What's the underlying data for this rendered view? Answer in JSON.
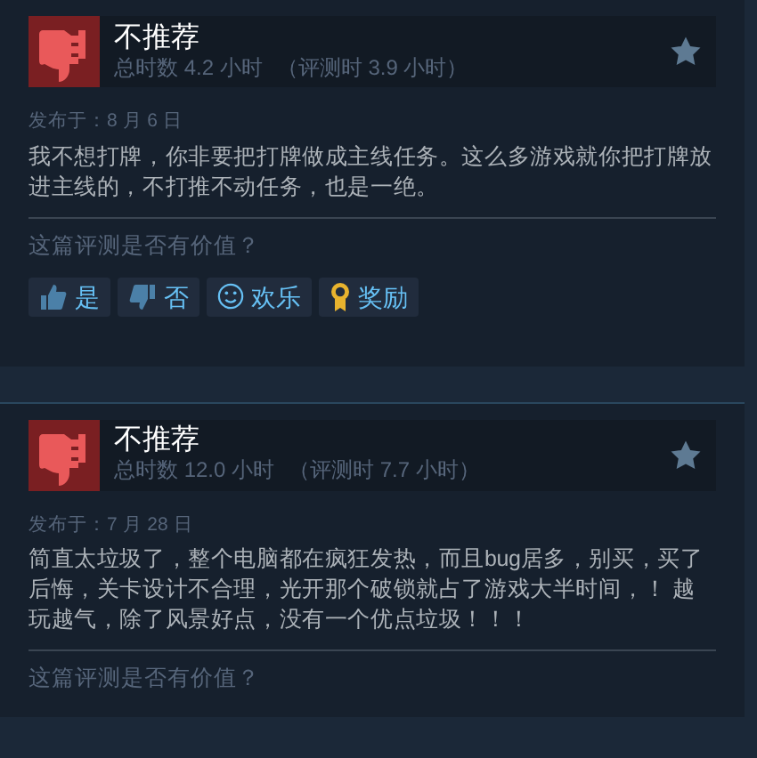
{
  "reviews": [
    {
      "verdict": "不推荐",
      "hours": "总时数 4.2 小时",
      "review_hours": "（评测时 3.9 小时）",
      "posted": "发布于：8 月 6 日",
      "body": "我不想打牌，你非要把打牌做成主线任务。这么多游戏就你把打牌放进主线的，不打推不动任务，也是一绝。",
      "question": "这篇评测是否有价值？",
      "votes": [
        {
          "kind": "thumb-up",
          "label": "是"
        },
        {
          "kind": "thumb-down",
          "label": "否"
        },
        {
          "kind": "smile",
          "label": "欢乐"
        },
        {
          "kind": "award",
          "label": "奖励"
        }
      ]
    },
    {
      "verdict": "不推荐",
      "hours": "总时数 12.0 小时",
      "review_hours": "（评测时 7.7 小时）",
      "posted": "发布于：7 月 28 日",
      "body": "简直太垃圾了，整个电脑都在疯狂发热，而且bug居多，别买，买了后悔，关卡设计不合理，光开那个破锁就占了游戏大半时间，！ 越玩越气，除了风景好点，没有一个优点垃圾！！！",
      "question": "这篇评测是否有价值？"
    }
  ]
}
